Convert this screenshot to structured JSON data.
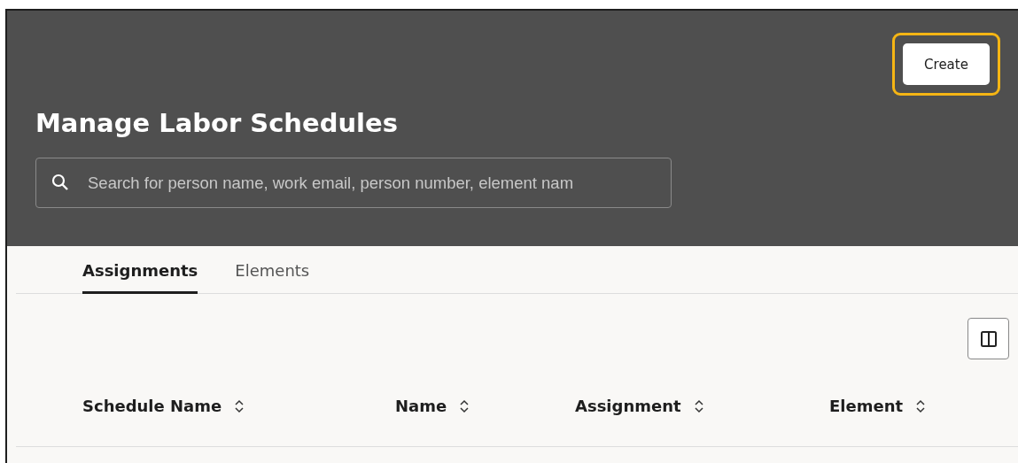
{
  "header": {
    "title": "Manage Labor Schedules",
    "create_button": {
      "label": "Create",
      "highlighted": true
    },
    "search": {
      "placeholder": "Search for person name, work email, person number, element nam"
    }
  },
  "tabs": [
    {
      "label": "Assignments",
      "selected": true
    },
    {
      "label": "Elements",
      "selected": false
    }
  ],
  "table": {
    "columns": [
      {
        "label": "Schedule Name"
      },
      {
        "label": "Name"
      },
      {
        "label": "Assignment"
      },
      {
        "label": "Element"
      }
    ]
  }
}
